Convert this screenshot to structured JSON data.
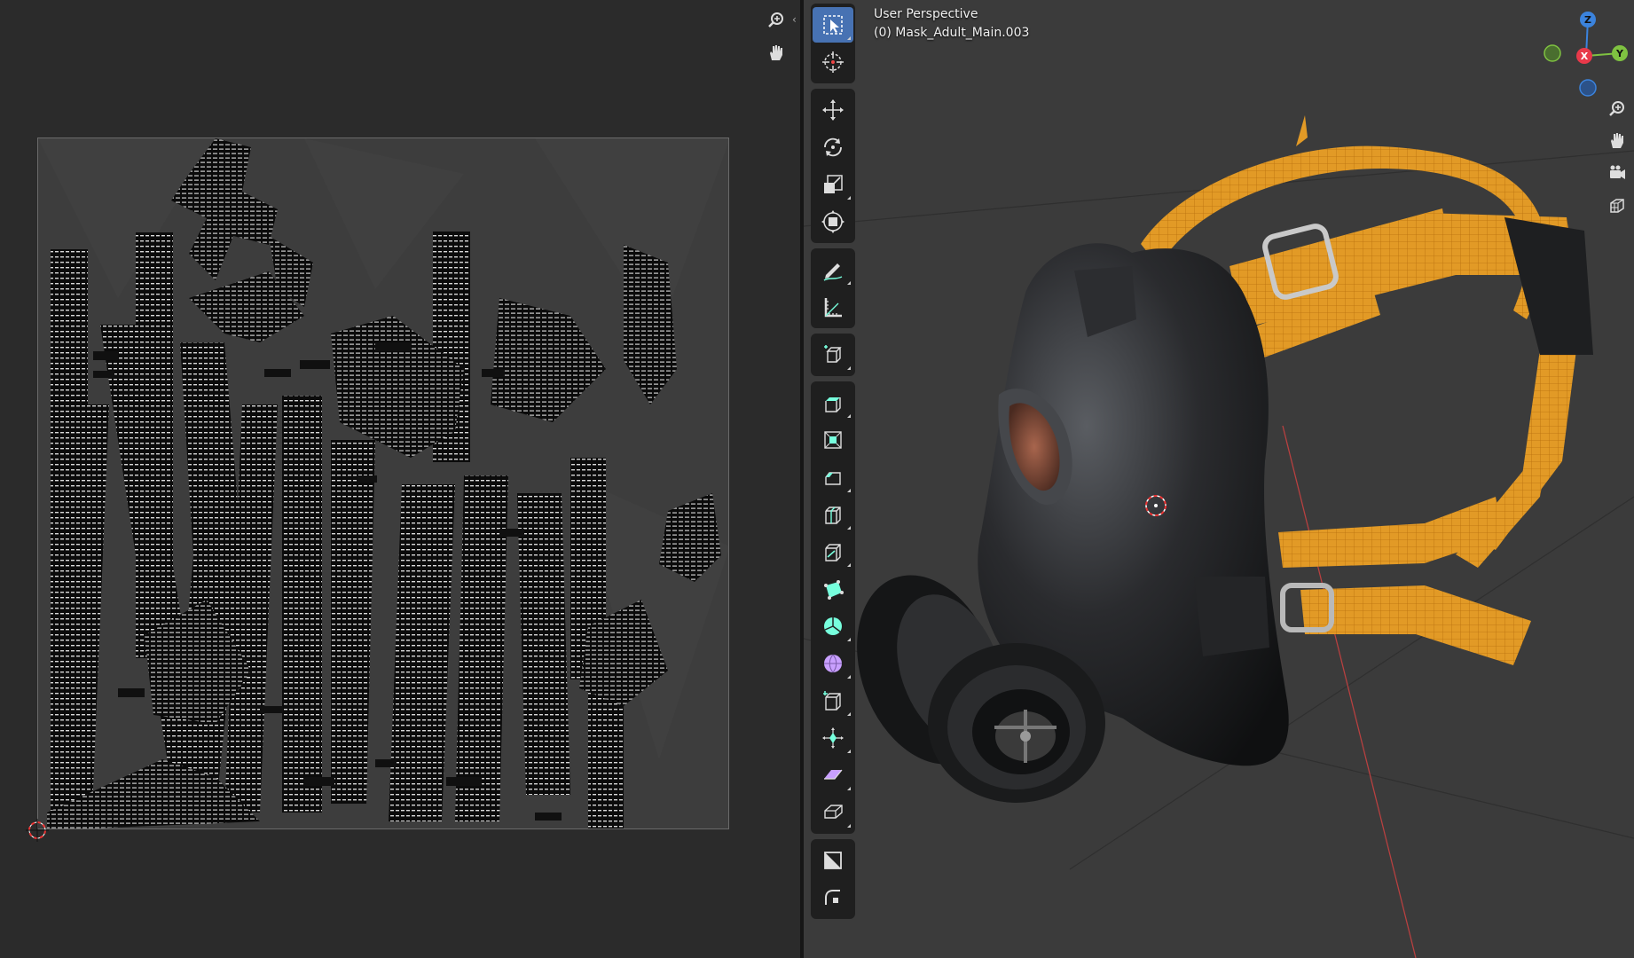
{
  "viewport": {
    "view_name": "User Perspective",
    "object_label": "(0) Mask_Adult_Main.003"
  },
  "gizmo": {
    "z_label": "Z",
    "y_label": "Y",
    "x_label": "X",
    "colors": {
      "x": "#e8394a",
      "y": "#7fc241",
      "z": "#3b83dd"
    }
  },
  "uv_editor": {
    "nav_icons": [
      "zoom-icon",
      "pan-hand-icon"
    ],
    "collapse_glyph": "‹"
  },
  "toolbar": {
    "tools": [
      {
        "name": "select-box",
        "active": true
      },
      {
        "name": "cursor"
      },
      {
        "name": "move"
      },
      {
        "name": "rotate"
      },
      {
        "name": "scale"
      },
      {
        "name": "transform"
      },
      {
        "name": "annotate"
      },
      {
        "name": "measure"
      },
      {
        "name": "add-cube"
      },
      {
        "name": "extrude-region"
      },
      {
        "name": "inset-faces"
      },
      {
        "name": "bevel"
      },
      {
        "name": "loop-cut"
      },
      {
        "name": "knife"
      },
      {
        "name": "poly-build"
      },
      {
        "name": "spin"
      },
      {
        "name": "smooth"
      },
      {
        "name": "edge-slide"
      },
      {
        "name": "shrink-fatten"
      },
      {
        "name": "shear"
      },
      {
        "name": "rip-region"
      },
      {
        "name": "sculpt-mode"
      },
      {
        "name": "crease"
      }
    ]
  },
  "colors": {
    "accent": "#4772b3",
    "strap_orange": "#e0921c",
    "mask_black": "#1c1d1f"
  }
}
